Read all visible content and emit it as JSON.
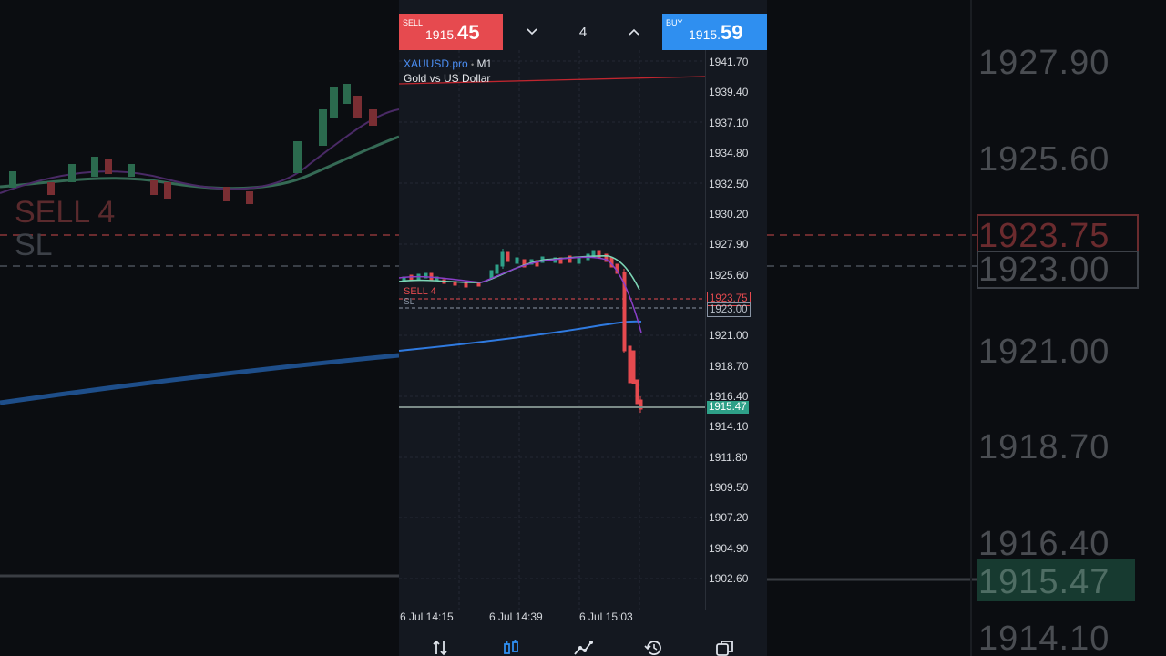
{
  "trade_bar": {
    "sell": {
      "caption": "SELL",
      "price_main": "1915.",
      "price_big": "45"
    },
    "buy": {
      "caption": "BUY",
      "price_main": "1915.",
      "price_big": "59"
    },
    "lot_size": "4",
    "down_icon": "chevron-down-icon",
    "up_icon": "chevron-up-icon"
  },
  "chart": {
    "symbol": "XAUUSD.pro",
    "timeframe": "M1",
    "description": "Gold vs US Dollar",
    "price_ticks": [
      "1941.70",
      "1939.40",
      "1937.10",
      "1934.80",
      "1932.50",
      "1930.20",
      "1927.90",
      "1925.60",
      "1923.75",
      "1923.00",
      "1921.00",
      "1918.70",
      "1916.40",
      "1915.47",
      "1914.10",
      "1911.80",
      "1909.50",
      "1907.20",
      "1904.90",
      "1902.60"
    ],
    "sell_line": {
      "label": "SELL 4",
      "price": "1923.75",
      "color": "#e64a4f"
    },
    "sl_line": {
      "label": "SL",
      "price": "1923.00",
      "color": "#8a95a5"
    },
    "current_price": {
      "price": "1915.47",
      "color": "#2ea088"
    },
    "time_labels": [
      "6 Jul 14:15",
      "6 Jul 14:39",
      "6 Jul 15:03"
    ]
  },
  "backdrop": {
    "sell_label": "SELL 4",
    "sl_label": "SL",
    "prices": [
      "1927.90",
      "1925.60",
      "1923.75",
      "1923.00",
      "1921.00",
      "1918.70",
      "1916.40",
      "1915.47",
      "1914.10"
    ]
  },
  "nav": [
    {
      "icon": "trade-arrows-icon"
    },
    {
      "icon": "candlestick-chart-icon"
    },
    {
      "icon": "indicators-icon"
    },
    {
      "icon": "history-icon"
    },
    {
      "icon": "copy-windows-icon"
    }
  ]
}
